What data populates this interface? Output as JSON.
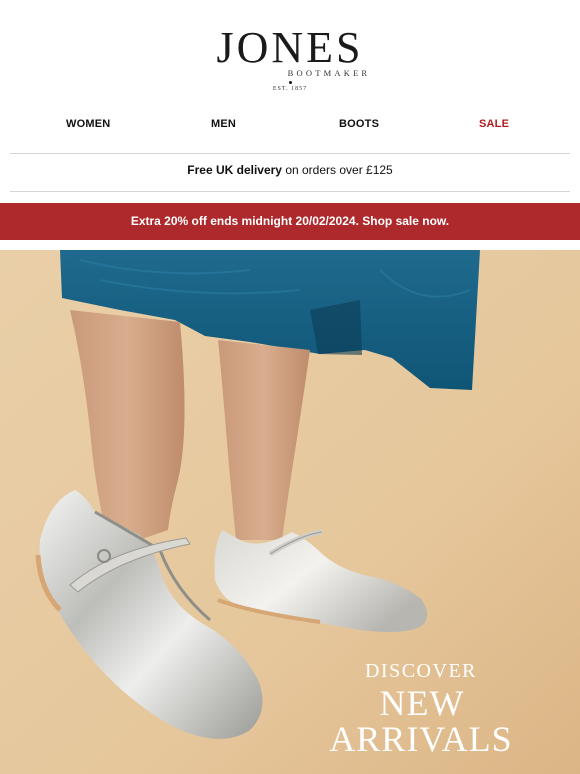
{
  "brand": {
    "name": "JONES",
    "sub": "BOOTMAKER",
    "established": "EST. 1857"
  },
  "nav": {
    "items": [
      {
        "label": "WOMEN"
      },
      {
        "label": "MEN"
      },
      {
        "label": "BOOTS"
      },
      {
        "label": "SALE"
      }
    ]
  },
  "delivery": {
    "bold": "Free UK delivery",
    "rest": " on orders over £125"
  },
  "promo": {
    "text": "Extra 20% off ends midnight 20/02/2024. Shop sale now."
  },
  "hero": {
    "line1": "DISCOVER",
    "line2": "NEW",
    "line3": "ARRIVALS"
  },
  "colors": {
    "sale_red": "#b01e23",
    "promo_bg": "#ad292c",
    "hero_bg": "#e8c9a0"
  }
}
